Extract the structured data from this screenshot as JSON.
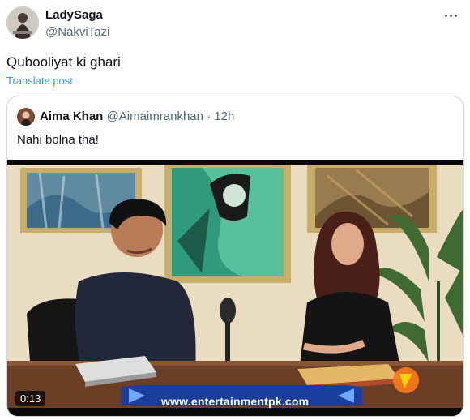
{
  "post": {
    "author_name": "LadySaga",
    "author_handle": "@NakviTazi",
    "text": "Qubooliyat ki ghari",
    "translate_label": "Translate post"
  },
  "quote": {
    "author_name": "Aima Khan",
    "author_handle": "@Aimaimrankhan",
    "separator": "·",
    "time": "12h",
    "text": "Nahi bolna tha!",
    "video": {
      "duration": "0:13",
      "watermark": "www.entertainmentpk.com"
    }
  },
  "icons": {
    "more": "more-horizontal-icon"
  }
}
